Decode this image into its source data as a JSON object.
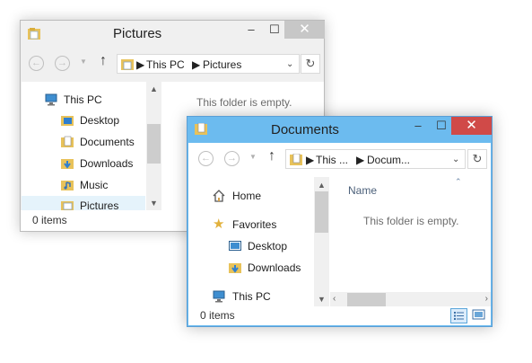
{
  "pictures_window": {
    "title": "Pictures",
    "minimize": "–",
    "maximize": "☐",
    "close": "✕",
    "address": {
      "root": "This PC",
      "current": "Pictures"
    },
    "tree": [
      {
        "label": "This PC",
        "icon": "computer-icon"
      },
      {
        "label": "Desktop",
        "icon": "folder-icon"
      },
      {
        "label": "Documents",
        "icon": "documents-folder-icon"
      },
      {
        "label": "Downloads",
        "icon": "downloads-folder-icon"
      },
      {
        "label": "Music",
        "icon": "music-folder-icon"
      },
      {
        "label": "Pictures",
        "icon": "pictures-folder-icon",
        "selected": true
      }
    ],
    "empty_text": "This folder is empty.",
    "status": "0 items"
  },
  "documents_window": {
    "title": "Documents",
    "minimize": "–",
    "maximize": "☐",
    "close": "✕",
    "address": {
      "root": "This ...",
      "current": "Docum..."
    },
    "tree": [
      {
        "label": "Home",
        "icon": "home-icon"
      },
      {
        "label": "Favorites",
        "icon": "star-icon"
      },
      {
        "label": "Desktop",
        "icon": "desktop-icon"
      },
      {
        "label": "Downloads",
        "icon": "downloads-folder-icon"
      },
      {
        "label": "This PC",
        "icon": "computer-icon"
      }
    ],
    "column_header": "Name",
    "empty_text": "This folder is empty.",
    "status": "0 items"
  },
  "colors": {
    "active_titlebar": "#6cbbef",
    "close_red": "#d04a48",
    "selection": "#e5f3fb"
  }
}
